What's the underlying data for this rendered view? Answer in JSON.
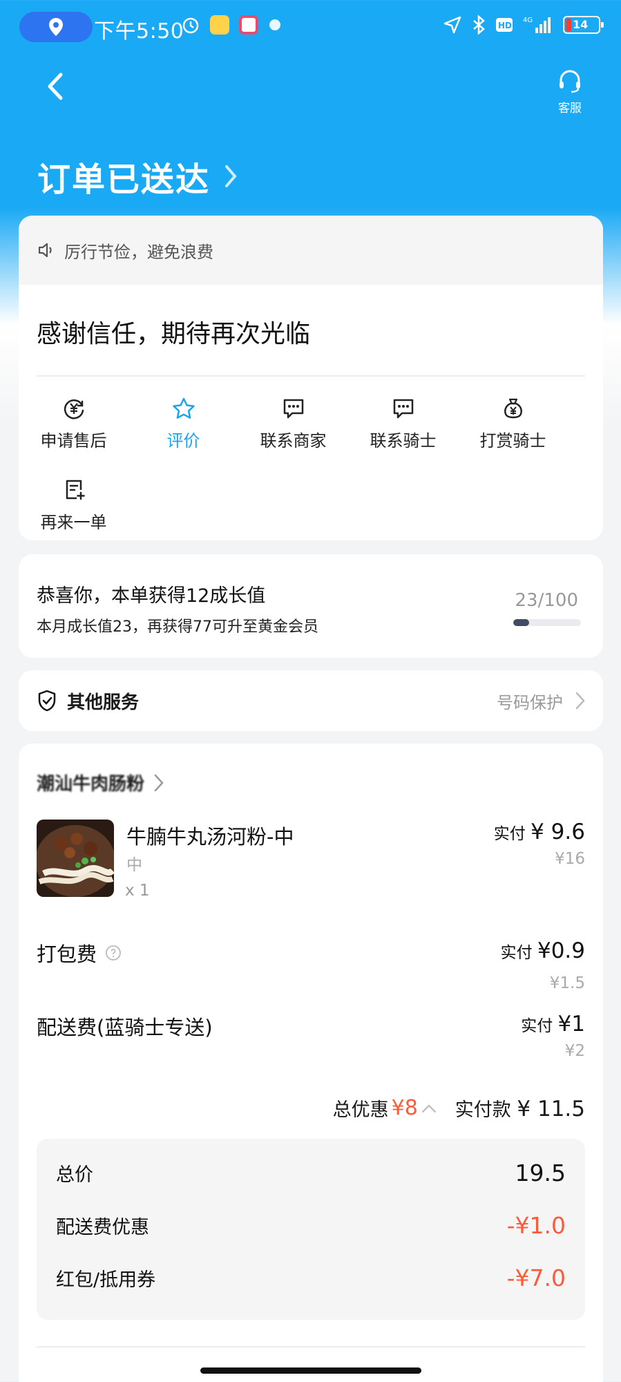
{
  "status_bar": {
    "time": "下午5:50",
    "battery": "14"
  },
  "header": {
    "service_label": "客服",
    "order_status": "订单已送达"
  },
  "notice": {
    "text": "厉行节俭，避免浪费"
  },
  "thanks": {
    "text": "感谢信任，期待再次光临"
  },
  "actions": [
    {
      "label": "申请售后",
      "icon": "yuan-refund-icon"
    },
    {
      "label": "评价",
      "icon": "star-icon"
    },
    {
      "label": "联系商家",
      "icon": "chat-icon"
    },
    {
      "label": "联系骑士",
      "icon": "chat-icon"
    },
    {
      "label": "打赏骑士",
      "icon": "money-bag-icon"
    },
    {
      "label": "再来一单",
      "icon": "reorder-icon"
    }
  ],
  "growth": {
    "title": "恭喜你，本单获得12成长值",
    "subtitle": "本月成长值23，再获得77可升至黄金会员",
    "progress_text": "23/100",
    "progress_value": 0.23
  },
  "other_services": {
    "title": "其他服务",
    "right_text": "号码保护"
  },
  "order": {
    "shop_name": "潮汕牛肉肠粉",
    "item": {
      "name": "牛腩牛丸汤河粉-中",
      "spec": "中",
      "qty": "x 1",
      "paid_prefix": "实付",
      "paid": "¥ 9.6",
      "original": "¥16"
    },
    "packing_fee": {
      "label": "打包费",
      "paid_prefix": "实付",
      "paid": "¥0.9",
      "original": "¥1.5"
    },
    "delivery_fee": {
      "label": "配送费(蓝骑士专送)",
      "paid_prefix": "实付",
      "paid": "¥1",
      "original": "¥2"
    },
    "summary": {
      "discount_label": "总优惠",
      "discount_value": "¥8",
      "paid_label": "实付款",
      "paid_value": "¥ 11.5"
    },
    "breakdown": [
      {
        "label": "总价",
        "value": "19.5"
      },
      {
        "label": "配送费优惠",
        "value": "-¥1.0"
      },
      {
        "label": "红包/抵用券",
        "value": "-¥7.0"
      }
    ]
  },
  "colors": {
    "header_blue": "#1aa9f5",
    "accent": "#1aa3f0",
    "discount_red": "#ff5a38"
  }
}
